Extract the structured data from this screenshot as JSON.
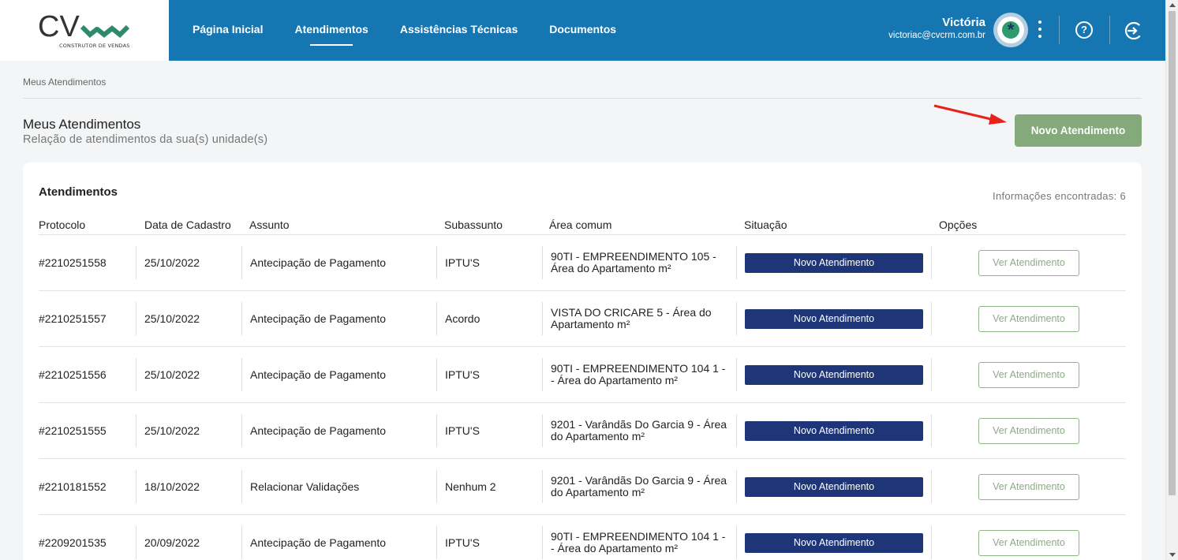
{
  "brand": {
    "logo_text": "CV",
    "logo_sub": "CONSTRUTOR DE VENDAS"
  },
  "nav": [
    {
      "label": "Página Inicial",
      "active": false
    },
    {
      "label": "Atendimentos",
      "active": true
    },
    {
      "label": "Assistências Técnicas",
      "active": false
    },
    {
      "label": "Documentos",
      "active": false
    }
  ],
  "user": {
    "name": "Victória",
    "email": "victoriac@cvcrm.com.br",
    "avatar_glyph": "*"
  },
  "icons": {
    "menu": "kebab-icon",
    "help": "help-icon",
    "logout": "logout-icon"
  },
  "breadcrumb": "Meus Atendimentos",
  "page": {
    "title": "Meus Atendimentos",
    "subtitle": "Relação de atendimentos da sua(s) unidade(s)",
    "new_button": "Novo Atendimento"
  },
  "table": {
    "title": "Atendimentos",
    "count_text": "Informações encontradas: 6",
    "headers": [
      "Protocolo",
      "Data de Cadastro",
      "Assunto",
      "Subassunto",
      "Área comum",
      "Situação",
      "Opções"
    ],
    "rows": [
      {
        "protocolo": "#2210251558",
        "data": "25/10/2022",
        "assunto": "Antecipação de Pagamento",
        "subassunto": "IPTU'S",
        "area": "90TI - EMPREENDIMENTO 105 - Área do Apartamento m²",
        "situacao": "Novo Atendimento",
        "acao": "Ver Atendimento"
      },
      {
        "protocolo": "#2210251557",
        "data": "25/10/2022",
        "assunto": "Antecipação de Pagamento",
        "subassunto": "Acordo",
        "area": "VISTA DO CRICARE 5 - Área do Apartamento m²",
        "situacao": "Novo Atendimento",
        "acao": "Ver Atendimento"
      },
      {
        "protocolo": "#2210251556",
        "data": "25/10/2022",
        "assunto": "Antecipação de Pagamento",
        "subassunto": "IPTU'S",
        "area": "90TI - EMPREENDIMENTO 104 1 - - Área do Apartamento m²",
        "situacao": "Novo Atendimento",
        "acao": "Ver Atendimento"
      },
      {
        "protocolo": "#2210251555",
        "data": "25/10/2022",
        "assunto": "Antecipação de Pagamento",
        "subassunto": "IPTU'S",
        "area": "9201 - Varândãs Do Garcia 9 - Área do Apartamento m²",
        "situacao": "Novo Atendimento",
        "acao": "Ver Atendimento"
      },
      {
        "protocolo": "#2210181552",
        "data": "18/10/2022",
        "assunto": "Relacionar Validações",
        "subassunto": "Nenhum 2",
        "area": "9201 - Varândãs Do Garcia 9 - Área do Apartamento m²",
        "situacao": "Novo Atendimento",
        "acao": "Ver Atendimento"
      },
      {
        "protocolo": "#2209201535",
        "data": "20/09/2022",
        "assunto": "Antecipação de Pagamento",
        "subassunto": "IPTU'S",
        "area": "90TI - EMPREENDIMENTO 104 1 - - Área do Apartamento m²",
        "situacao": "Novo Atendimento",
        "acao": "Ver Atendimento"
      }
    ]
  },
  "colors": {
    "header": "#1676b2",
    "primary_button": "#84a97b",
    "status_badge": "#1e3578",
    "annotation_arrow": "#e8221b"
  }
}
